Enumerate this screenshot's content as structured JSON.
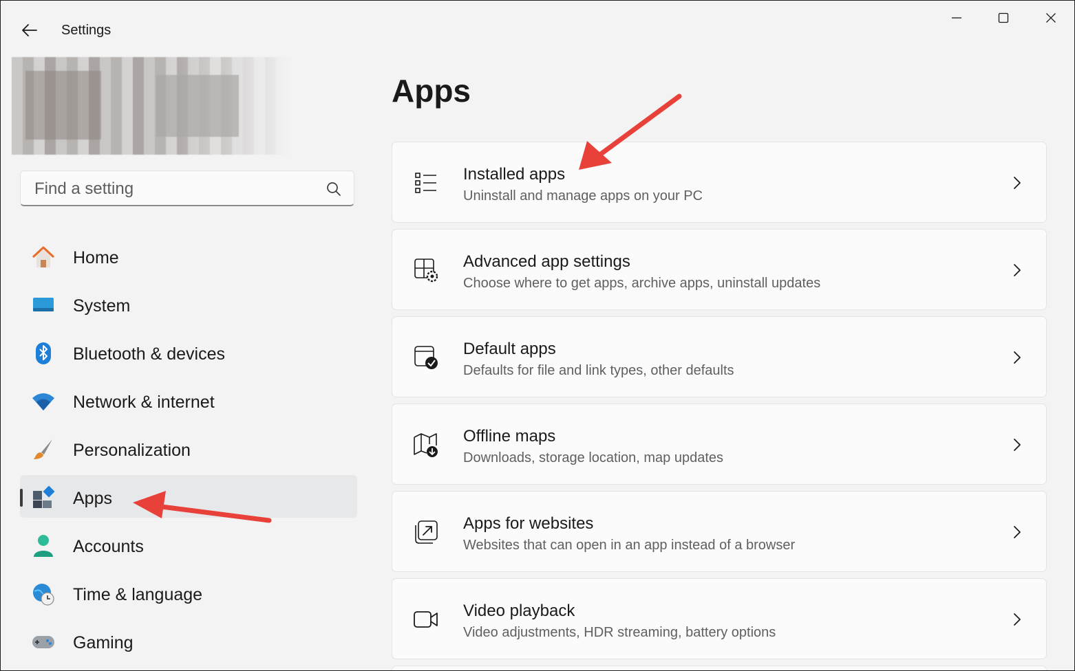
{
  "window": {
    "title": "Settings"
  },
  "search": {
    "placeholder": "Find a setting"
  },
  "sidebar": {
    "items": [
      {
        "label": "Home",
        "icon": "home-icon"
      },
      {
        "label": "System",
        "icon": "system-icon"
      },
      {
        "label": "Bluetooth & devices",
        "icon": "bluetooth-icon"
      },
      {
        "label": "Network & internet",
        "icon": "wifi-icon"
      },
      {
        "label": "Personalization",
        "icon": "brush-icon"
      },
      {
        "label": "Apps",
        "icon": "apps-icon",
        "selected": true
      },
      {
        "label": "Accounts",
        "icon": "person-icon"
      },
      {
        "label": "Time & language",
        "icon": "globe-clock-icon"
      },
      {
        "label": "Gaming",
        "icon": "gamepad-icon"
      }
    ]
  },
  "main": {
    "title": "Apps",
    "cards": [
      {
        "title": "Installed apps",
        "subtitle": "Uninstall and manage apps on your PC",
        "icon": "list-icon"
      },
      {
        "title": "Advanced app settings",
        "subtitle": "Choose where to get apps, archive apps, uninstall updates",
        "icon": "app-settings-icon"
      },
      {
        "title": "Default apps",
        "subtitle": "Defaults for file and link types, other defaults",
        "icon": "default-apps-icon"
      },
      {
        "title": "Offline maps",
        "subtitle": "Downloads, storage location, map updates",
        "icon": "map-download-icon"
      },
      {
        "title": "Apps for websites",
        "subtitle": "Websites that can open in an app instead of a browser",
        "icon": "open-external-icon"
      },
      {
        "title": "Video playback",
        "subtitle": "Video adjustments, HDR streaming, battery options",
        "icon": "video-icon"
      }
    ]
  },
  "colors": {
    "accent": "#0067c0",
    "annotation_arrow": "#e8413a"
  }
}
